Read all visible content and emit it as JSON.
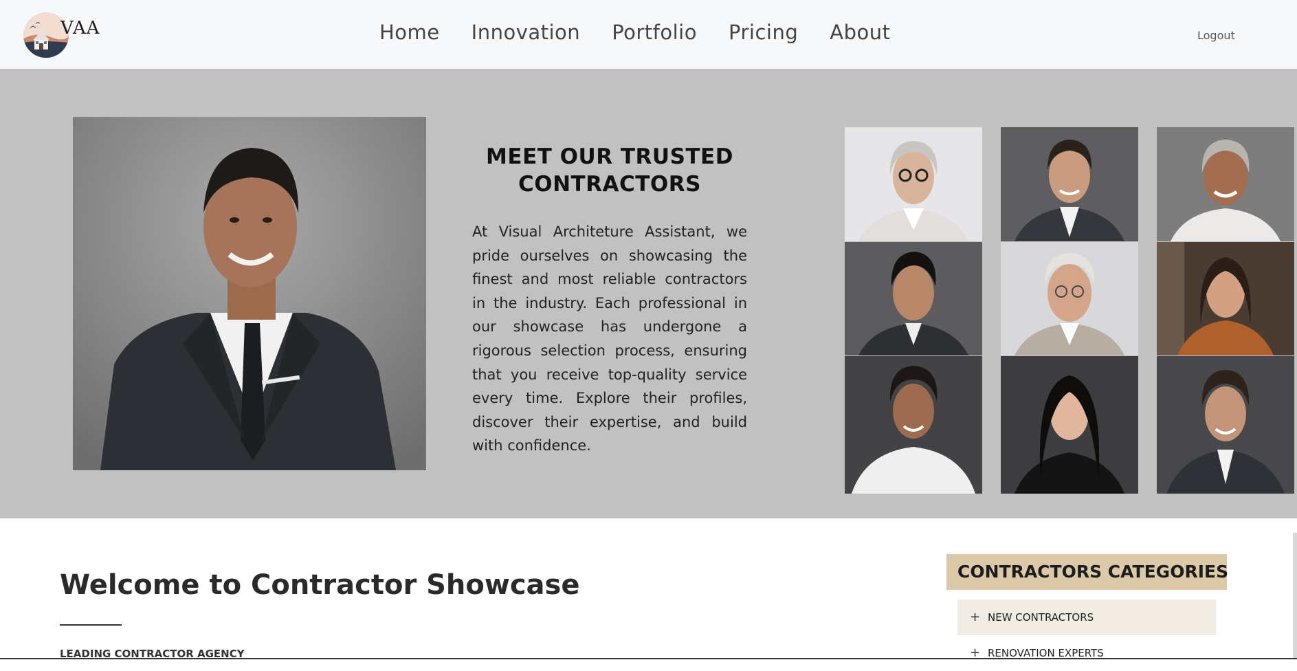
{
  "header": {
    "logo_text": "VAA",
    "nav": [
      "Home",
      "Innovation",
      "Portfolio",
      "Pricing",
      "About"
    ],
    "logout_label": "Logout"
  },
  "hero": {
    "title_line1": "MEET OUR TRUSTED",
    "title_line2": "CONTRACTORS",
    "body": "At Visual Architeture Assistant, we pride ourselves on showcasing the finest and most reliable contractors in the industry. Each professional in our showcase has undergone a rigorous selection process, ensuring that you receive top-quality service every time. Explore their profiles, discover their expertise, and build with confidence."
  },
  "welcome": {
    "title": "Welcome to Contractor Showcase",
    "subtitle": "LEADING CONTRACTOR AGENCY"
  },
  "categories": {
    "header": "CONTRACTORS CATEGORIES",
    "items": [
      "NEW CONTRACTORS",
      "RENOVATION EXPERTS"
    ]
  }
}
